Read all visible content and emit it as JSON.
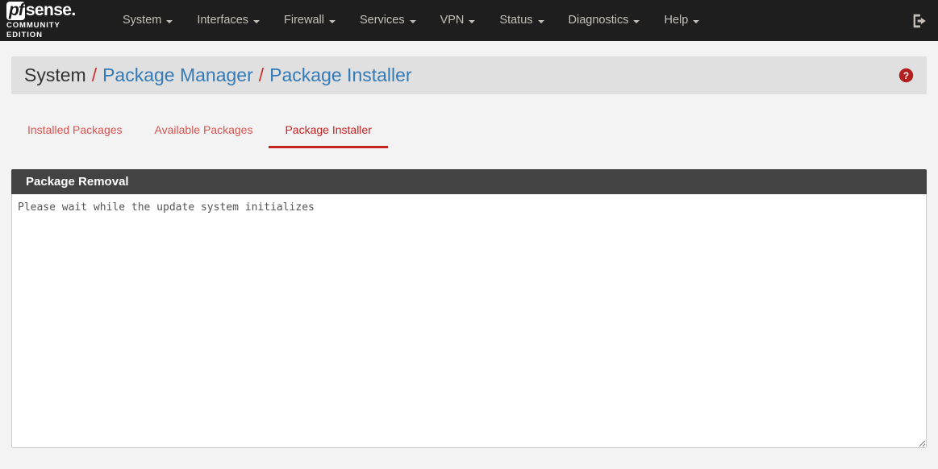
{
  "navbar": {
    "brand": {
      "pf": "pf",
      "sense": "sense",
      "dot": ".",
      "edition": "COMMUNITY EDITION"
    },
    "menu": [
      {
        "label": "System",
        "has_caret": true
      },
      {
        "label": "Interfaces",
        "has_caret": true
      },
      {
        "label": "Firewall",
        "has_caret": true
      },
      {
        "label": "Services",
        "has_caret": true
      },
      {
        "label": "VPN",
        "has_caret": true
      },
      {
        "label": "Status",
        "has_caret": true
      },
      {
        "label": "Diagnostics",
        "has_caret": true
      },
      {
        "label": "Help",
        "has_caret": true
      }
    ],
    "logout_icon": "sign-out-icon",
    "background_color": "#1e1e1e",
    "text_color": "#c5c0b9"
  },
  "breadcrumb": {
    "root": "System",
    "separator": "/",
    "links": [
      "Package Manager",
      "Package Installer"
    ],
    "link_color": "#337ab7",
    "separator_color": "#cf2e2e",
    "help_icon": "question-circle-icon",
    "help_icon_color": "#b31e1e"
  },
  "tabs": {
    "items": [
      {
        "label": "Installed Packages",
        "active": false
      },
      {
        "label": "Available Packages",
        "active": false
      },
      {
        "label": "Package Installer",
        "active": true
      }
    ],
    "active_color": "#c52222",
    "inactive_color": "#d9534f"
  },
  "panel": {
    "title": "Package Removal",
    "heading_background": "#434343",
    "console_text": "Please wait while the update system initializes",
    "console_placeholder": ""
  }
}
